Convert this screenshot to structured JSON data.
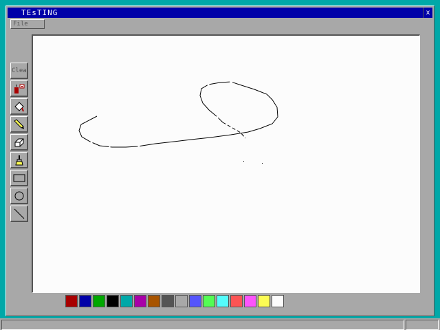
{
  "window": {
    "title": "TEsTING",
    "close_label": "x"
  },
  "menu": {
    "file_label": "File"
  },
  "toolbar": {
    "clear_label": "Clear",
    "tools": [
      {
        "name": "color-picker-icon"
      },
      {
        "name": "fill-bucket-icon"
      },
      {
        "name": "pencil-icon"
      },
      {
        "name": "eraser-icon"
      },
      {
        "name": "brush-icon"
      },
      {
        "name": "rectangle-icon"
      },
      {
        "name": "circle-icon"
      },
      {
        "name": "line-icon"
      }
    ]
  },
  "palette": {
    "colors": [
      "#a80000",
      "#0000a8",
      "#00a800",
      "#000000",
      "#00a8a8",
      "#a800a8",
      "#a85400",
      "#545454",
      "#a8a8a8",
      "#5454fc",
      "#54fc54",
      "#54fcfc",
      "#fc5454",
      "#fc54fc",
      "#fcfc54",
      "#fcfcfc"
    ]
  },
  "colors": {
    "desktop": "#00a8a8",
    "titlebar": "#0000a8",
    "face": "#a8a8a8",
    "canvas": "#fcfcfc"
  }
}
